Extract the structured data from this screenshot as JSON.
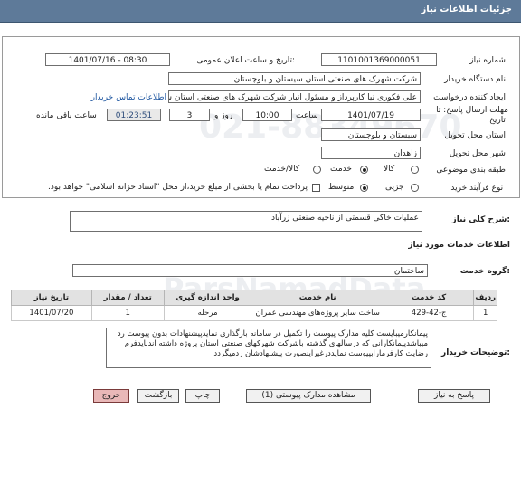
{
  "header": {
    "title": "جزئیات اطلاعات نیاز"
  },
  "need_number": {
    "label": "شماره نیاز:",
    "value": "1101001369000051"
  },
  "announce": {
    "label": "تاریخ و ساعت اعلان عمومی:",
    "value": "1401/07/16 - 08:30"
  },
  "buyer": {
    "label": "نام دستگاه خریدار:",
    "value": "شرکت شهرک های صنعتی استان سیستان و بلوچستان"
  },
  "creator": {
    "label": "ایجاد کننده درخواست:",
    "value": "علی  فکوری نیا کارپرداز و مسئول انبار شرکت شهرک های صنعتی استان سیستان و بلوچستان",
    "contact_link": "اطلاعات تماس خریدار"
  },
  "deadline": {
    "label": "مهلت ارسال پاسخ: تا تاریخ:",
    "date": "1401/07/19",
    "time_label": "ساعت",
    "time": "10:00",
    "days": "3",
    "days_label": "روز و",
    "remaining": "01:23:51",
    "remaining_label": "ساعت باقی مانده"
  },
  "province": {
    "label": "استان محل تحویل:",
    "value": "سیستان و بلوچستان"
  },
  "city": {
    "label": "شهر محل تحویل:",
    "value": "زاهدان"
  },
  "category": {
    "label": "طبقه بندی موضوعی:",
    "options": [
      "کالا",
      "خدمت",
      "کالا/خدمت"
    ],
    "selected": "خدمت"
  },
  "process": {
    "label": "نوع فرآیند خرید :",
    "options": [
      "جزیی",
      "متوسط"
    ],
    "selected": "متوسط",
    "note": "پرداخت تمام یا بخشی از مبلغ خرید،از محل \"اسناد خزانه اسلامی\" خواهد بود."
  },
  "description": {
    "label": "شرح کلی نیاز:",
    "value": "عملیات خاکی قسمتی از ناحیه صنعتی زرآباد"
  },
  "services_title": "اطلاعات خدمات مورد نیاز",
  "service_group": {
    "label": "گروه خدمت:",
    "value": "ساختمان"
  },
  "table": {
    "headers": [
      "ردیف",
      "کد خدمت",
      "نام خدمت",
      "واحد اندازه گیری",
      "تعداد / مقدار",
      "تاریخ نیاز"
    ],
    "rows": [
      [
        "1",
        "ج-42-429",
        "ساخت سایر پروژه‌های مهندسی عمران",
        "مرحله",
        "1",
        "1401/07/20"
      ]
    ]
  },
  "buyer_notes": {
    "label": "توضیحات خریدار:",
    "text": "پیمانکارمیبایست کلیه مدارک پیوست را تکمیل در سامانه بارگذاری نمایدپیشنهادات بدون پیوست رد میباشدپیمانکارانی که درسالهای گذشته باشرکت شهرکهای صنعتی استان پروژه داشته اندبایدفرم رضایت کارفرمارابپیوست نمایددرغیراینصورت پیشنهادشان ردمیگردد"
  },
  "buttons": {
    "reply": "پاسخ به نیاز",
    "attachments": "مشاهده مدارک پیوستی (1)",
    "print": "چاپ",
    "back": "بازگشت",
    "exit": "خروج"
  },
  "watermark": {
    "line1": "ParsNamadData",
    "line2": "021-88349670"
  }
}
